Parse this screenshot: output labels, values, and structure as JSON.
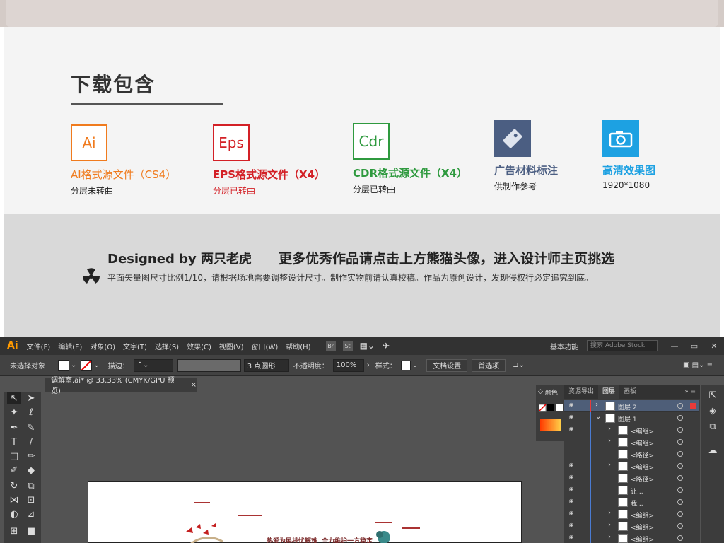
{
  "downloads": {
    "title": "下载包含",
    "items": [
      {
        "badge": "Ai",
        "title": "AI格式源文件（CS4）",
        "sub": "分层未转曲",
        "color": "#f07b1e"
      },
      {
        "badge": "Eps",
        "title": "EPS格式源文件（X4）",
        "sub": "分层已转曲",
        "color": "#d32026"
      },
      {
        "badge": "Cdr",
        "title": "CDR格式源文件（X4）",
        "sub": "分层已转曲",
        "color": "#2f9a3f"
      },
      {
        "icon": "tag-icon",
        "title": "广告材料标注",
        "sub": "供制作参考",
        "color": "#4b5e82"
      },
      {
        "icon": "camera-icon",
        "title": "高清效果图",
        "sub": "1920*1080",
        "color": "#1da1e2"
      }
    ]
  },
  "designer": {
    "by": "Designed by 两只老虎",
    "more": "更多优秀作品请点击上方熊猫头像，进入设计师主页挑选",
    "note": "平面矢量图尺寸比例1/10，请根据场地需要调整设计尺寸。制作实物前请认真校稿。作品为原创设计，发现侵权行必定追究到底。"
  },
  "illustrator": {
    "logo": "Ai",
    "menu": [
      "文件(F)",
      "编辑(E)",
      "对象(O)",
      "文字(T)",
      "选择(S)",
      "效果(C)",
      "视图(V)",
      "窗口(W)",
      "帮助(H)"
    ],
    "menu_icons": [
      "Br",
      "St"
    ],
    "workspace": "基本功能",
    "stock_search": "搜索 Adobe Stock",
    "window_buttons": [
      "—",
      "▭",
      "✕"
    ],
    "control": {
      "no_selection": "未选择对象",
      "stroke_label": "描边：",
      "brush": "3 点圆形",
      "opacity_label": "不透明度：",
      "opacity_value": "100%",
      "style_label": "样式：",
      "doc_setup": "文档设置",
      "preferences": "首选项"
    },
    "doc_tab": "调解室.ai* @ 33.33% (CMYK/GPU 预览)",
    "doc_close": "×",
    "canvas": {
      "text1": "热爱为民排忧解难",
      "text2": "全力维护一方稳定"
    },
    "color_tab": "颜色",
    "panel_tabs": [
      "资源导出",
      "图层",
      "画板"
    ],
    "active_panel_tab": "图层",
    "layers": [
      {
        "name": "图层 2",
        "level": 0,
        "expanded": false,
        "bar": "#e83a3a"
      },
      {
        "name": "图层 1",
        "level": 0,
        "expanded": true,
        "bar": "#4a7bd1"
      },
      {
        "name": "<编组>",
        "level": 1,
        "expanded": false,
        "bar": "#4a7bd1"
      },
      {
        "name": "<编组>",
        "level": 1,
        "expanded": false,
        "bar": "#4a7bd1"
      },
      {
        "name": "<路径>",
        "level": 1,
        "expanded": null,
        "bar": "#4a7bd1"
      },
      {
        "name": "<编组>",
        "level": 1,
        "expanded": false,
        "bar": "#4a7bd1"
      },
      {
        "name": "<路径>",
        "level": 1,
        "expanded": null,
        "bar": "#4a7bd1"
      },
      {
        "name": "让...",
        "level": 1,
        "expanded": null,
        "bar": "#4a7bd1"
      },
      {
        "name": "我...",
        "level": 1,
        "expanded": null,
        "bar": "#4a7bd1"
      },
      {
        "name": "<编组>",
        "level": 1,
        "expanded": false,
        "bar": "#4a7bd1"
      },
      {
        "name": "<编组>",
        "level": 1,
        "expanded": false,
        "bar": "#4a7bd1"
      },
      {
        "name": "<编组>",
        "level": 1,
        "expanded": false,
        "bar": "#4a7bd1"
      }
    ]
  }
}
